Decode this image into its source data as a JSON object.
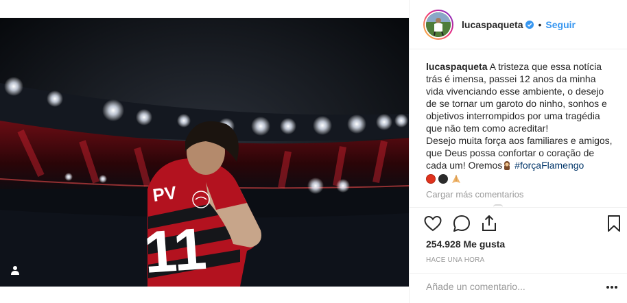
{
  "post": {
    "username": "lucaspaqueta",
    "verified": true,
    "separator": "•",
    "follow_label": "Seguir",
    "caption": {
      "username": "lucaspaqueta",
      "text_part1": "A tristeza que essa notícia trás é imensa, passei 12 anos da minha vida vivenciando esse ambiente, o desejo de se tornar um garoto do ninho, sonhos e objetivos interrompidos por uma tragédia que não tem como acreditar!",
      "text_part2": "Desejo muita força aos familiares e amigos, que Deus possa confortar o coração de cada um! Oremos",
      "hashtag": "#forçaFlamengo",
      "emojis": [
        "red-circle",
        "black-circle",
        "praying-hands"
      ]
    },
    "load_more_label": "Cargar más comentarios",
    "likes_label": "254.928 Me gusta",
    "timestamp": "HACE UNA HORA",
    "comment_placeholder": "Añade un comentario...",
    "photo": {
      "jersey_text": "PV",
      "jersey_number": "11"
    }
  },
  "icons": {
    "like": "heart-outline-icon",
    "comment": "speech-bubble-icon",
    "share": "share-icon",
    "save": "bookmark-icon",
    "more": "more-dots-icon",
    "tagged": "user-tag-icon"
  },
  "colors": {
    "accent_blue": "#3897f0",
    "hashtag_blue": "#003569",
    "muted_gray": "#999999",
    "text": "#262626",
    "flamengo_red": "#c8102e"
  }
}
